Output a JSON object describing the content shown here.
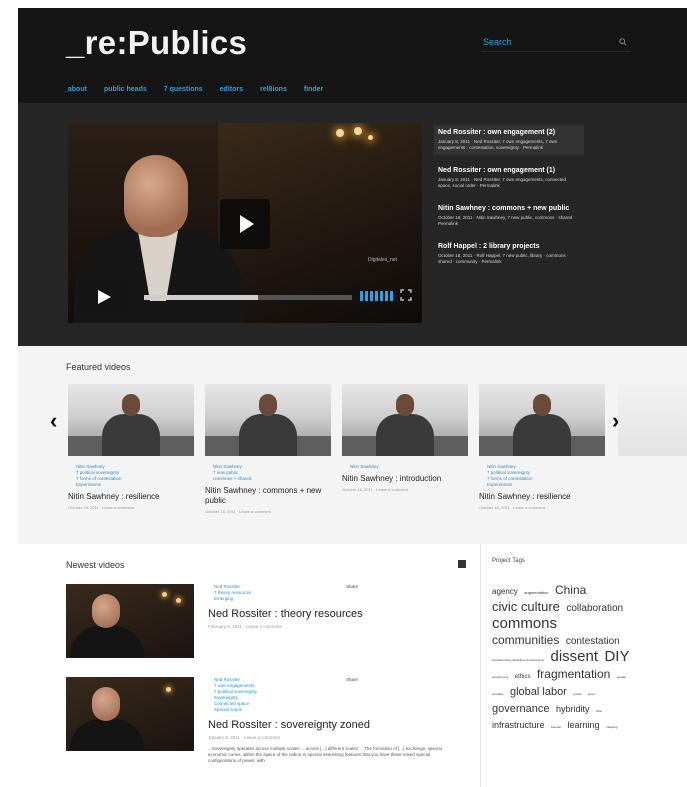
{
  "header": {
    "logo": "_re:Publics",
    "search_placeholder": "Search",
    "nav": [
      "_about",
      "public heads",
      "7 questions",
      "editors",
      "rel8ions",
      "finder"
    ]
  },
  "hero": {
    "watermark": "Digitales_net",
    "playback_progress": 0.55,
    "playlist": [
      {
        "title": "Ned Rossiter : own engagement (2)",
        "meta": "January 8, 2011 · Ned Rossiter, 7 own engagements, 7 own engagements · contestation, sovereignty · Permalink",
        "active": true
      },
      {
        "title": "Ned Rossiter : own engagement (1)",
        "meta": "January 8, 2011 · Ned Rossiter, 7 own engagements, connected space, social order · Permalink",
        "active": false
      },
      {
        "title": "Nitin Sawhney : commons + new public",
        "meta": "October 18, 2011 · Nitin Sawhney, 7 new public, commons · shared · Permalink",
        "active": false
      },
      {
        "title": "Rolf Happel : 2 library projects",
        "meta": "October 18, 2011 · Rolf Happel, 7 new public, library · commons · shared · community · Permalink",
        "active": false
      }
    ]
  },
  "featured": {
    "heading": "Featured videos",
    "items": [
      {
        "tags": [
          "Nitin Sawhney",
          "7 political sovereignty",
          "7 forms of contestation",
          "Experiments"
        ],
        "title": "Nitin Sawhney : resilience",
        "meta": "October 18, 2011 · Leave a comment"
      },
      {
        "tags": [
          "Nitin Sawhney",
          "7 new public",
          "commons + shared"
        ],
        "title": "Nitin Sawhney : commons + new public",
        "meta": "October 18, 2011 · Leave a comment"
      },
      {
        "tags": [
          "Nitin Sawhney"
        ],
        "title": "Nitin Sawhney : introduction",
        "meta": "October 18, 2011 · Leave a comment"
      },
      {
        "tags": [
          "Nitin Sawhney",
          "7 political sovereignty",
          "7 forms of contestation",
          "Experiments"
        ],
        "title": "Nitin Sawhney : resilience",
        "meta": "October 18, 2011 · Leave a comment"
      }
    ]
  },
  "newest": {
    "heading": "Newest videos",
    "items": [
      {
        "tags": [
          "Ned Rossiter",
          "7 theory resources",
          "Emerging"
        ],
        "share": "Share",
        "title": "Ned Rossiter : theory resources",
        "meta": "February 8, 2011 · Leave a comment",
        "excerpt": ""
      },
      {
        "tags": [
          "Ned Rossiter",
          "7 own engagements",
          "7 political sovereignty",
          "Sovereignty",
          "Connected space",
          "Special zones"
        ],
        "share": "Share",
        "title": "Ned Rossiter : sovereignty zoned",
        "meta": "January 8, 2011 · Leave a comment",
        "excerpt": "...Sovereignty operates across multiple scales ... across [...] different scales ... The formation of [...] exchange, special economic zones, within the space of the nation to special interesting features that you have these mixed special configurations of power, with"
      }
    ]
  },
  "project_tags": {
    "heading": "Project Tags",
    "tags": [
      {
        "label": "agency",
        "size": 8
      },
      {
        "label": "augmentation",
        "size": 4
      },
      {
        "label": "China",
        "size": 12
      },
      {
        "label": "civic culture",
        "size": 13
      },
      {
        "label": "collaboration",
        "size": 10
      },
      {
        "label": "commons",
        "size": 15
      },
      {
        "label": "communities",
        "size": 12
      },
      {
        "label": "contestation",
        "size": 10
      },
      {
        "label": "crowdsourcing discipline of sovereignty",
        "size": 3
      },
      {
        "label": "dissent",
        "size": 15
      },
      {
        "label": "DIY",
        "size": 15
      },
      {
        "label": "employment",
        "size": 3
      },
      {
        "label": "ethics",
        "size": 6
      },
      {
        "label": "fragmentation",
        "size": 12
      },
      {
        "label": "gender",
        "size": 3
      },
      {
        "label": "empathy",
        "size": 3
      },
      {
        "label": "global labor",
        "size": 11
      },
      {
        "label": "goods",
        "size": 3
      },
      {
        "label": "gruuv",
        "size": 3
      },
      {
        "label": "governance",
        "size": 11
      },
      {
        "label": "hybridity",
        "size": 9
      },
      {
        "label": "infra",
        "size": 3
      },
      {
        "label": "infrastructure",
        "size": 9
      },
      {
        "label": "internet",
        "size": 3
      },
      {
        "label": "learning",
        "size": 9
      },
      {
        "label": "mapping",
        "size": 3
      }
    ]
  }
}
